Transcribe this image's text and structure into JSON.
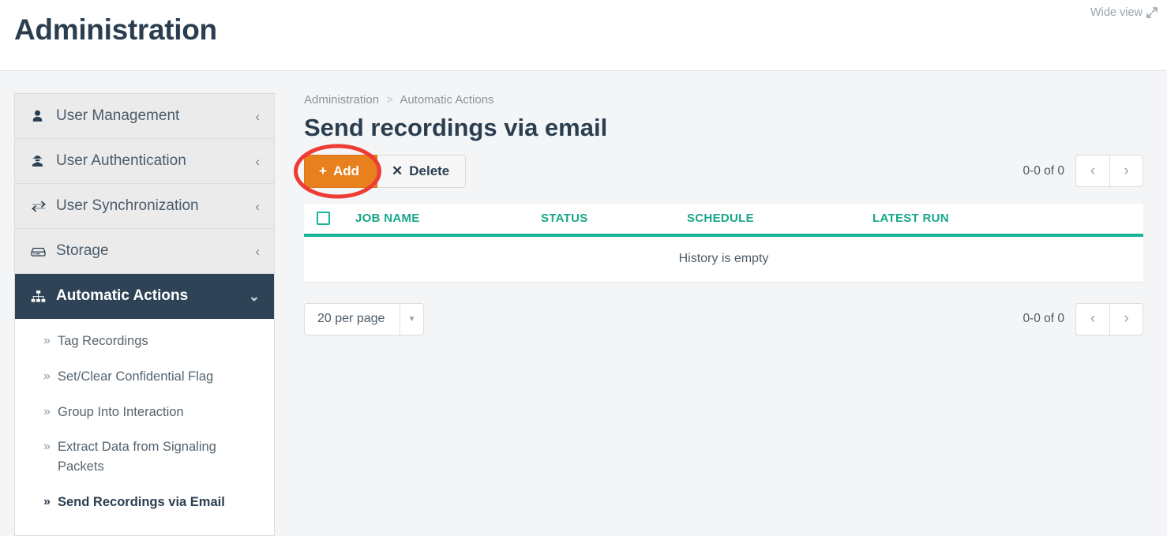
{
  "header": {
    "title": "Administration",
    "wide_view_label": "Wide view",
    "wide_view_icon": "expand-arrow-icon"
  },
  "sidebar": {
    "items": [
      {
        "label": "User Management",
        "icon": "user-icon",
        "caret": "‹",
        "active": false
      },
      {
        "label": "User Authentication",
        "icon": "user-secret-icon",
        "caret": "‹",
        "active": false
      },
      {
        "label": "User Synchronization",
        "icon": "exchange-icon",
        "caret": "‹",
        "active": false
      },
      {
        "label": "Storage",
        "icon": "hdd-icon",
        "caret": "‹",
        "active": false
      },
      {
        "label": "Automatic Actions",
        "icon": "sitemap-icon",
        "caret": "⌄",
        "active": true
      }
    ],
    "subitems": [
      {
        "label": "Tag Recordings",
        "marker": "»",
        "active": false
      },
      {
        "label": "Set/Clear Confidential Flag",
        "marker": "»",
        "active": false
      },
      {
        "label": "Group Into Interaction",
        "marker": "»",
        "active": false
      },
      {
        "label": "Extract Data from Signaling Packets",
        "marker": "»",
        "active": false
      },
      {
        "label": "Send Recordings via Email",
        "marker": "»",
        "active": true
      }
    ]
  },
  "main": {
    "breadcrumb": [
      "Administration",
      "Automatic Actions"
    ],
    "breadcrumb_separator": ">",
    "title": "Send recordings via email",
    "toolbar": {
      "add_label": "Add",
      "add_icon": "plus-icon",
      "delete_label": "Delete",
      "delete_icon": "times-icon"
    },
    "pager_top": {
      "count": "0-0 of 0",
      "prev_icon": "chevron-left-icon",
      "next_icon": "chevron-right-icon"
    },
    "table": {
      "select_all_icon": "checkbox-unchecked-icon",
      "columns": [
        "JOB NAME",
        "STATUS",
        "SCHEDULE",
        "LATEST RUN"
      ],
      "rows": [],
      "empty_message": "History is empty"
    },
    "footer": {
      "per_page_value": "20 per page",
      "per_page_arrow_icon": "caret-down-icon",
      "pager": {
        "count": "0-0 of 0",
        "prev_icon": "chevron-left-icon",
        "next_icon": "chevron-right-icon"
      }
    }
  },
  "annotation": {
    "shape": "ellipse-highlight",
    "color": "#ee3b33",
    "target": "add-button"
  },
  "colors": {
    "accent_teal": "#18b497",
    "accent_orange": "#e8801e",
    "nav_active": "#2e4356",
    "text_dark": "#2b3e50",
    "annotation_red": "#ee3b33"
  }
}
